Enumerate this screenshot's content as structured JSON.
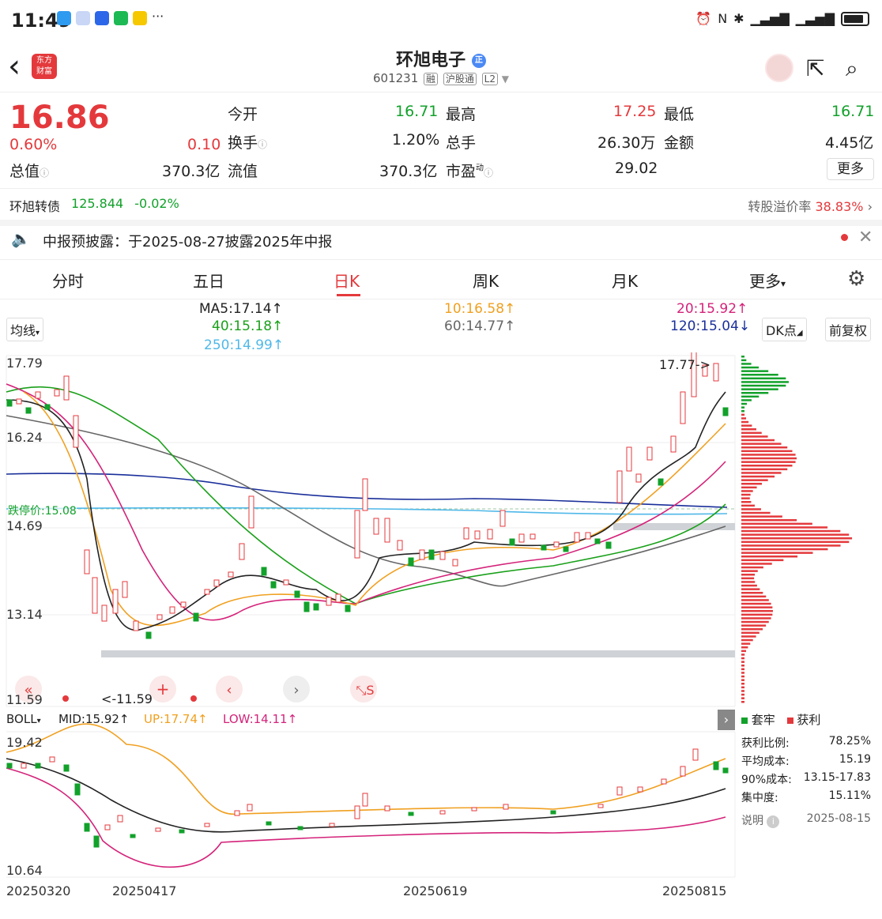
{
  "status_bar": {
    "time": "11:49"
  },
  "header": {
    "title": "环旭电子",
    "badge": "正",
    "code": "601231",
    "tags": [
      "融",
      "沪股通",
      "L2"
    ],
    "logo_text": "东方财富"
  },
  "quote": {
    "price": "16.86",
    "change_pct": "0.60%",
    "change": "0.10",
    "open_label": "今开",
    "open": "16.71",
    "high_label": "最高",
    "high": "17.25",
    "low_label": "最低",
    "low": "16.71",
    "turnover_label": "换手",
    "turnover": "1.20%",
    "volume_label": "总手",
    "volume": "26.30万",
    "amount_label": "金额",
    "amount": "4.45亿",
    "mcap_label": "总值",
    "mcap": "370.3亿",
    "float_label": "流值",
    "float": "370.3亿",
    "pe_label": "市盈",
    "pe_sup": "动",
    "pe": "29.02",
    "more": "更多"
  },
  "bond": {
    "name": "环旭转债",
    "price": "125.844",
    "change": "-0.02%",
    "premium_label": "转股溢价率",
    "premium": "38.83%"
  },
  "notice": {
    "text": "中报预披露：于2025-08-27披露2025年中报"
  },
  "tabs": [
    "分时",
    "五日",
    "日K",
    "周K",
    "月K",
    "更多"
  ],
  "ma": {
    "selector": "均线",
    "ma5": "MA5:17.14↑",
    "ma10": "10:16.58↑",
    "ma20": "20:15.92↑",
    "ma40": "40:15.18↑",
    "ma60": "60:14.77↑",
    "ma120": "120:15.04↓",
    "ma250": "250:14.99↑",
    "dk": "DK点",
    "adjust": "前复权"
  },
  "chart": {
    "y_ticks": [
      "17.79",
      "16.24",
      "14.69",
      "13.14",
      "11.59"
    ],
    "limit_label": "跌停价:15.08",
    "max_label": "17.77->",
    "min_label": "<-11.59"
  },
  "boll": {
    "name": "BOLL",
    "mid": "MID:15.92↑",
    "up": "UP:17.74↑",
    "low": "LOW:14.11↑",
    "y_top": "19.42",
    "y_bottom": "10.64"
  },
  "x_dates": [
    "20250320",
    "20250417",
    "20250619",
    "20250815"
  ],
  "chip": {
    "legend_trapped": "套牢",
    "legend_profit": "获利",
    "profit_ratio_label": "获利比例:",
    "profit_ratio": "78.25%",
    "avg_cost_label": "平均成本:",
    "avg_cost": "15.19",
    "cost90_label": "90%成本:",
    "cost90": "13.15-17.83",
    "concentration_label": "集中度:",
    "concentration": "15.11%",
    "note_label": "说明",
    "date": "2025-08-15"
  },
  "colors": {
    "up": "#e4393c",
    "down": "#12a12a",
    "ma5": "#222222",
    "ma10": "#f0a020",
    "ma20": "#d4237a",
    "ma40": "#1aa01a",
    "ma60": "#666666",
    "ma120": "#1a2f9a",
    "ma250": "#4fb8e8"
  }
}
